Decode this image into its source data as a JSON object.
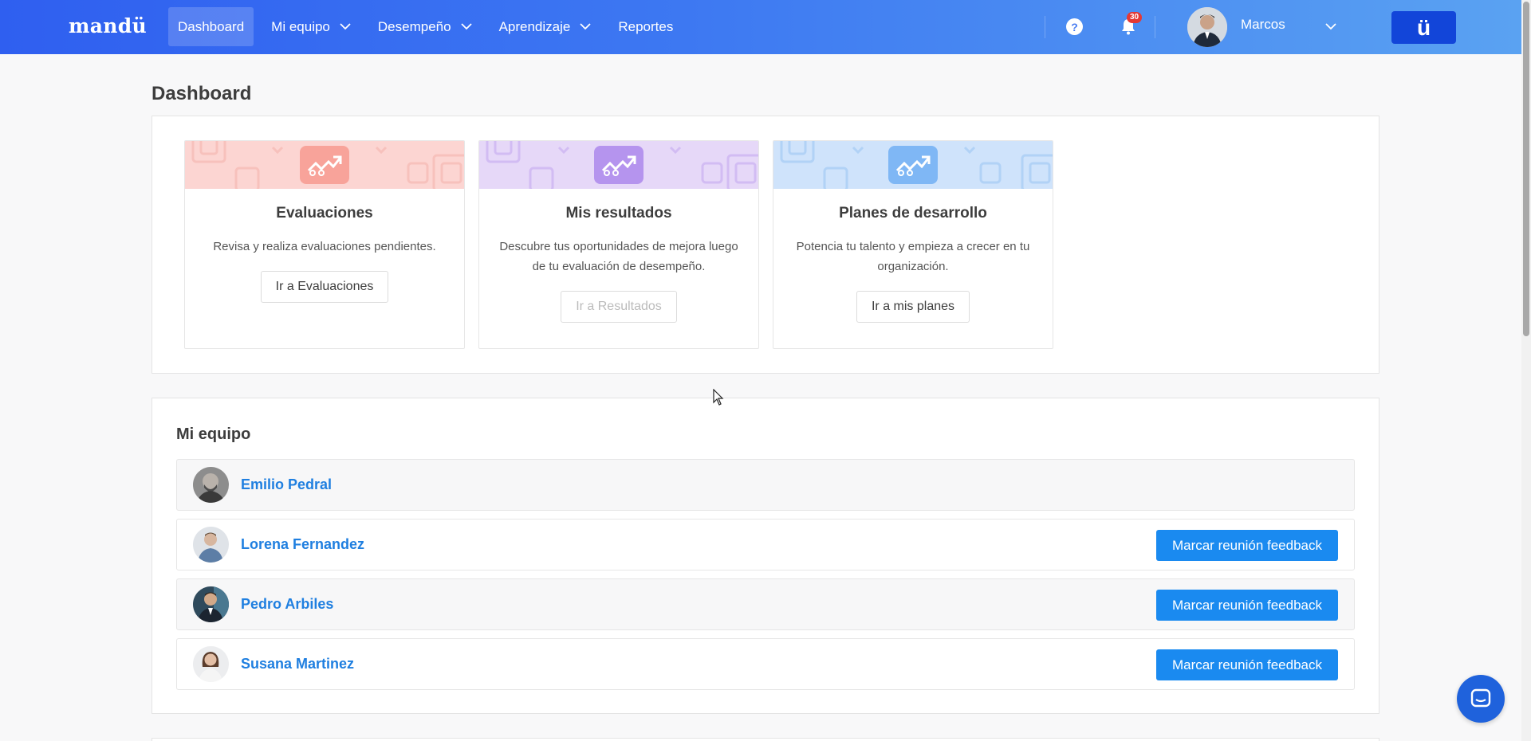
{
  "brand": {
    "logo_text": "mandü",
    "button_glyph": "ü",
    "primary_color": "#2f5ff0",
    "link_color": "#1f7fe0",
    "button_color": "#1a8af0"
  },
  "nav": {
    "items": [
      {
        "label": "Dashboard",
        "active": true,
        "dropdown": false
      },
      {
        "label": "Mi equipo",
        "active": false,
        "dropdown": true
      },
      {
        "label": "Desempeño",
        "active": false,
        "dropdown": true
      },
      {
        "label": "Aprendizaje",
        "active": false,
        "dropdown": true
      },
      {
        "label": "Reportes",
        "active": false,
        "dropdown": false
      }
    ],
    "help_glyph": "?",
    "notifications_count": "30",
    "user_name": "Marcos"
  },
  "page": {
    "title": "Dashboard"
  },
  "cards": [
    {
      "title": "Evaluaciones",
      "description": "Revisa y realiza evaluaciones pendientes.",
      "button": "Ir a Evaluaciones",
      "disabled": false,
      "color": "#fcd5d2",
      "icon_color": "#f8a39a"
    },
    {
      "title": "Mis resultados",
      "description": "Descubre tus oportunidades de mejora luego de tu evaluación de desempeño.",
      "button": "Ir a Resultados",
      "disabled": true,
      "color": "#e6d8f8",
      "icon_color": "#b594ee"
    },
    {
      "title": "Planes de desarrollo",
      "description": "Potencia tu talento y empieza a crecer en tu organización.",
      "button": "Ir a mis planes",
      "disabled": false,
      "color": "#cfe3fb",
      "icon_color": "#7fb7f5"
    }
  ],
  "team": {
    "title": "Mi equipo",
    "feedback_label": "Marcar reunión feedback",
    "members": [
      {
        "name": "Emilio Pedral",
        "has_feedback_button": false
      },
      {
        "name": "Lorena Fernandez",
        "has_feedback_button": true
      },
      {
        "name": "Pedro Arbiles",
        "has_feedback_button": true
      },
      {
        "name": "Susana Martinez",
        "has_feedback_button": true
      }
    ]
  },
  "icons": [
    "help-icon",
    "bell-icon",
    "chevron-down-icon",
    "growth-chart-icon",
    "chat-icon"
  ]
}
